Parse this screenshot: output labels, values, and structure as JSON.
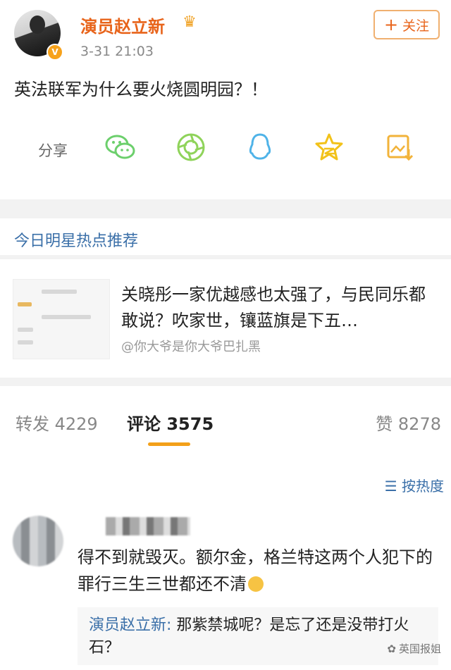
{
  "post": {
    "username": "演员赵立新",
    "verified_badge": "V",
    "time": "3-31 21:03",
    "follow_label": "关注",
    "text": "英法联军为什么要火烧圆明园？！",
    "share_label": "分享",
    "share_icons": [
      "wechat-icon",
      "moments-icon",
      "qq-icon",
      "qzone-icon",
      "save-image-icon"
    ]
  },
  "recommend": {
    "title": "今日明星热点推荐",
    "text": "关晓彤一家优越感也太强了，与民同乐都敢说？吹家世，镶蓝旗是下五…",
    "source": "@你大爷是你大爷巴扎黑"
  },
  "tabs": {
    "repost": "转发 4229",
    "comment": "评论 3575",
    "like": "赞 8278",
    "accent": "#f3a019"
  },
  "comments": {
    "sort_label": "按热度",
    "items": [
      {
        "text": "得不到就毁灭。额尔金，格兰特这两个人犯下的罪行三生三世都还不清",
        "reply_name": "演员赵立新:",
        "reply_text": "那紫禁城呢？是忘了还是没带打火石？"
      }
    ]
  },
  "watermark": "英国报姐"
}
